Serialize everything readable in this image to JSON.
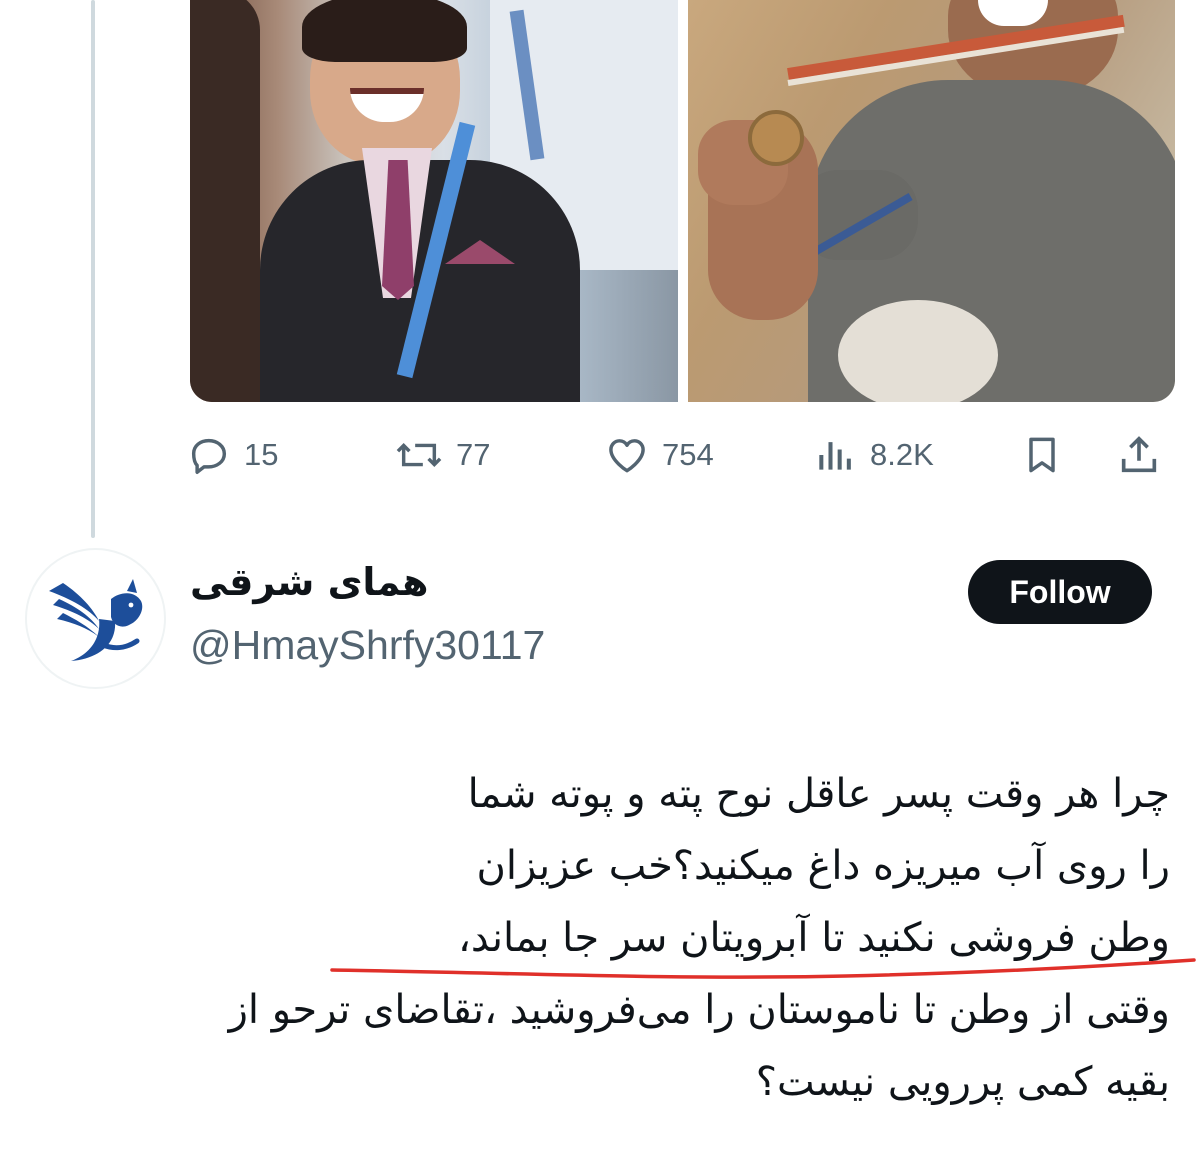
{
  "actions": {
    "replies": "15",
    "reposts": "77",
    "likes": "754",
    "views": "8.2K"
  },
  "profile": {
    "display_name": "همای شرقی",
    "handle": "@HmayShrfy30117",
    "follow_label": "Follow"
  },
  "tweet": {
    "lines": [
      "چرا هر وقت پسر عاقل نوح پته و پوته شما",
      "را روی آب میریزه داغ میکنید؟خب عزیزان",
      "وطن فروشی نکنید تا آبرویتان سر جا بماند،",
      "وقتی از وطن تا ناموستان را می‌فروشید ،تقاضای ترحو از",
      "بقیه کمی پررویی نیست؟"
    ]
  },
  "colors": {
    "text": "#0f1419",
    "muted": "#536471",
    "underline": "#e0302a",
    "logo_blue": "#1d4e9a"
  },
  "icons": [
    "reply-icon",
    "repost-icon",
    "like-icon",
    "views-icon",
    "bookmark-icon",
    "share-icon",
    "homa-logo-icon"
  ]
}
